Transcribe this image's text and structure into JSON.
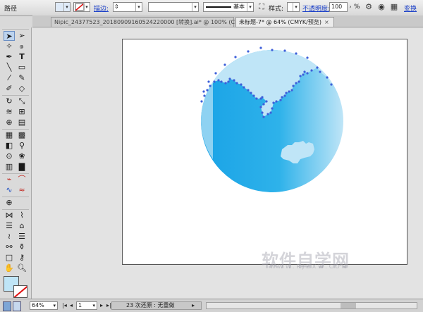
{
  "control_bar": {
    "object_type": "路径",
    "stroke_label": "描边:",
    "stroke_profile_label": "基本",
    "style_label": "样式:",
    "opacity_label": "不透明度:",
    "opacity_value": "100",
    "opacity_unit": "%",
    "transform_label": "变换"
  },
  "tabs": [
    {
      "label": "Nipic_24377523_20180909160524220000 [转换].ai* @ 100% (CMYK/预览)"
    },
    {
      "label": "未标题-7* @ 64% (CMYK/预览)"
    }
  ],
  "status_bar": {
    "zoom": "64%",
    "page": "1",
    "status_text": "23 次还原 : 无重做"
  },
  "watermark": {
    "text": "软件自学网",
    "subtext": "WWW.RJZXW.COM"
  },
  "colors": {
    "globe_light": "#bfe5f7",
    "globe_blue": "#1aa3e6",
    "anchor_point": "#3d5fd9"
  }
}
